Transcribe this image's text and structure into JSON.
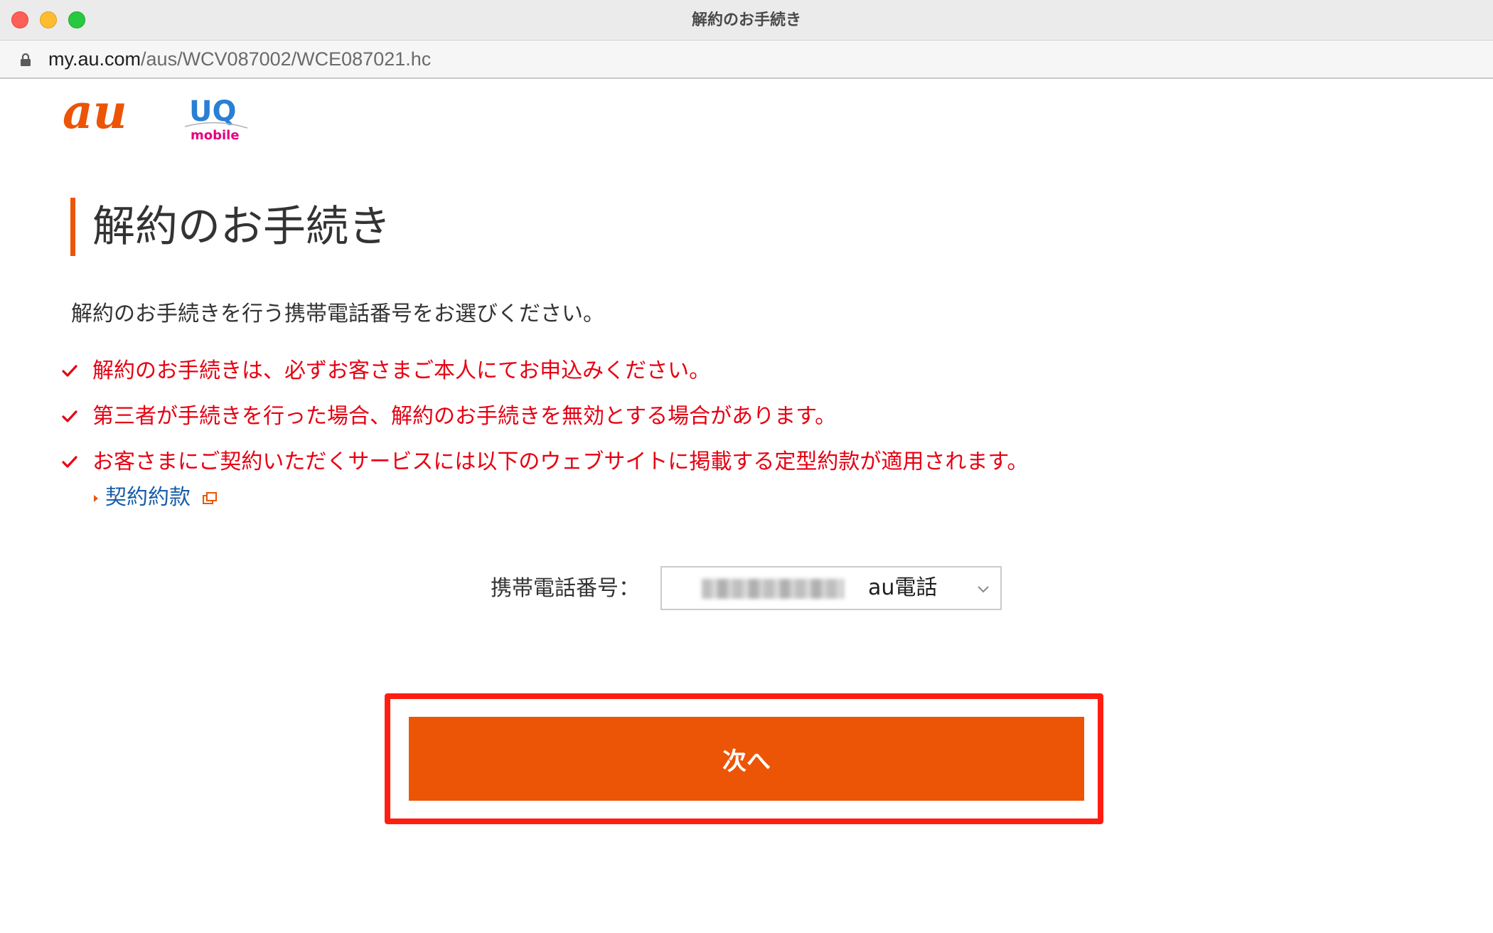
{
  "window": {
    "title": "解約のお手続き"
  },
  "address_bar": {
    "host": "my.au.com",
    "path": "/aus/WCV087002/WCE087021.hc",
    "lock_icon": "lock-icon"
  },
  "logos": {
    "au": "au",
    "uq_main": "UQ",
    "uq_sub": "mobile"
  },
  "page": {
    "title": "解約のお手続き",
    "intro": "解約のお手続きを行う携帯電話番号をお選びください。",
    "notices": [
      "解約のお手続きは、必ずお客さまご本人にてお申込みください。",
      "第三者が手続きを行った場合、解約のお手続きを無効とする場合があります。",
      "お客さまにご契約いただくサービスには以下のウェブサイトに掲載する定型約款が適用されます。"
    ],
    "contract_link": "契約約款"
  },
  "phone_select": {
    "label": "携帯電話番号：",
    "selected_value": "au電話"
  },
  "next_button": {
    "label": "次へ"
  },
  "colors": {
    "accent": "#eb5505",
    "notice_red": "#e60012",
    "link_blue": "#1a5ea8",
    "highlight_red": "#ff1e10"
  }
}
